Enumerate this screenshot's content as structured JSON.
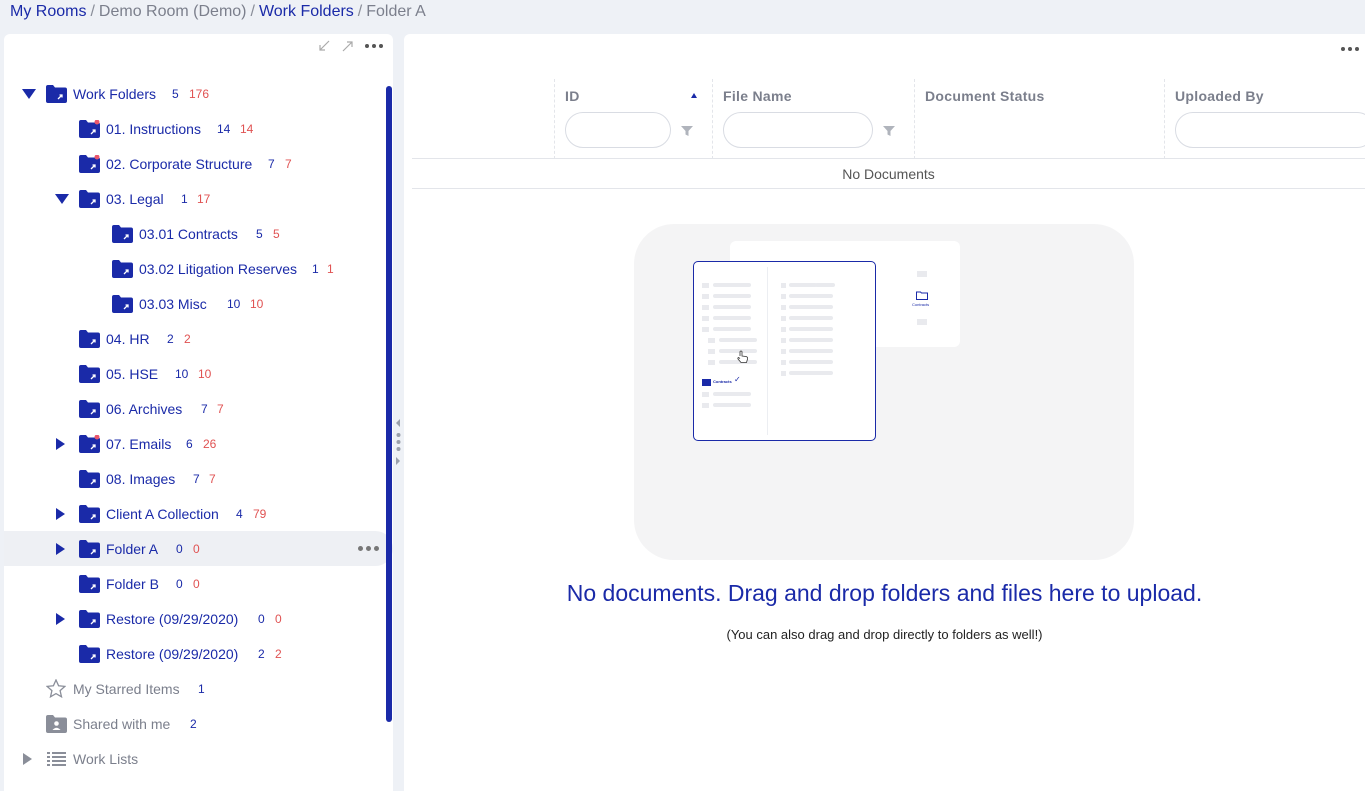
{
  "breadcrumb": {
    "my_rooms": "My Rooms",
    "room": "Demo Room (Demo)",
    "work_folders": "Work Folders",
    "current": "Folder A",
    "separator": "/"
  },
  "tree": {
    "work_folders": {
      "label": "Work Folders",
      "count": "5",
      "total": "176"
    },
    "instructions": {
      "label": "01. Instructions",
      "count": "14",
      "total": "14"
    },
    "corporate": {
      "label": "02. Corporate Structure",
      "count": "7",
      "total": "7"
    },
    "legal": {
      "label": "03. Legal",
      "count": "1",
      "total": "17"
    },
    "contracts": {
      "label": "03.01 Contracts",
      "count": "5",
      "total": "5"
    },
    "litigation": {
      "label": "03.02 Litigation Reserves",
      "count": "1",
      "total": "1"
    },
    "misc": {
      "label": "03.03 Misc",
      "count": "10",
      "total": "10"
    },
    "hr": {
      "label": "04. HR",
      "count": "2",
      "total": "2"
    },
    "hse": {
      "label": "05. HSE",
      "count": "10",
      "total": "10"
    },
    "archives": {
      "label": "06. Archives",
      "count": "7",
      "total": "7"
    },
    "emails": {
      "label": "07. Emails",
      "count": "6",
      "total": "26"
    },
    "images": {
      "label": "08. Images",
      "count": "7",
      "total": "7"
    },
    "client_a": {
      "label": "Client A Collection",
      "count": "4",
      "total": "79"
    },
    "folder_a": {
      "label": "Folder A",
      "count": "0",
      "total": "0"
    },
    "folder_b": {
      "label": "Folder B",
      "count": "0",
      "total": "0"
    },
    "restore1": {
      "label": "Restore (09/29/2020)",
      "count": "0",
      "total": "0"
    },
    "restore2": {
      "label": "Restore (09/29/2020)",
      "count": "2",
      "total": "2"
    },
    "starred": {
      "label": "My Starred Items",
      "count": "1"
    },
    "shared": {
      "label": "Shared with me",
      "count": "2"
    },
    "work_lists": {
      "label": "Work Lists"
    }
  },
  "grid": {
    "columns": {
      "id": "ID",
      "file_name": "File Name",
      "status": "Document Status",
      "uploaded_by": "Uploaded By"
    },
    "no_docs": "No Documents"
  },
  "empty_state": {
    "illustration_label": "Contracts",
    "title": "No documents. Drag and drop folders and files here to upload.",
    "subtitle": "(You can also drag and drop directly to folders as well!)"
  },
  "colors": {
    "primary": "#1a2aa8",
    "count_red": "#e05252",
    "muted": "#7b7f8c",
    "badge": "#e8566c"
  }
}
